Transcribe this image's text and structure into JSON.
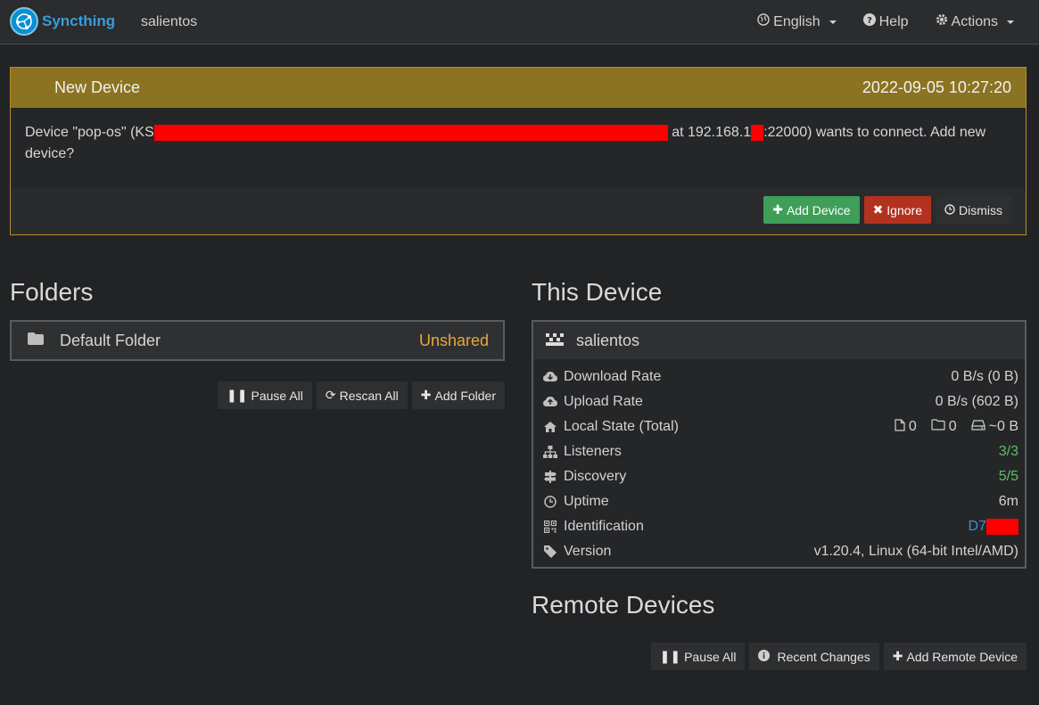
{
  "nav": {
    "brand": "Syncthing",
    "device_name": "salientos",
    "language": "English",
    "help": "Help",
    "actions": "Actions"
  },
  "notice": {
    "title": "New Device",
    "timestamp": "2022-09-05 10:27:20",
    "message_prefix": "Device \"pop-os\" (KS",
    "message_mid": " at 192.168.1",
    "message_suffix": ":22000) wants to connect. Add new device?",
    "add_label": "Add Device",
    "ignore_label": "Ignore",
    "dismiss_label": "Dismiss"
  },
  "folders": {
    "heading": "Folders",
    "items": [
      {
        "name": "Default Folder",
        "status": "Unshared"
      }
    ],
    "pause_all": "Pause All",
    "rescan_all": "Rescan All",
    "add_folder": "Add Folder"
  },
  "this_device": {
    "heading": "This Device",
    "name": "salientos",
    "rows": {
      "download": {
        "label": "Download Rate",
        "value": "0 B/s (0 B)"
      },
      "upload": {
        "label": "Upload Rate",
        "value": "0 B/s (602 B)"
      },
      "local_state": {
        "label": "Local State (Total)",
        "files": "0",
        "dirs": "0",
        "size": "~0 B"
      },
      "listeners": {
        "label": "Listeners",
        "value": "3/3"
      },
      "discovery": {
        "label": "Discovery",
        "value": "5/5"
      },
      "uptime": {
        "label": "Uptime",
        "value": "6m"
      },
      "identification": {
        "label": "Identification",
        "value": "D7"
      },
      "version": {
        "label": "Version",
        "value": "v1.20.4, Linux (64-bit Intel/AMD)"
      }
    }
  },
  "remote": {
    "heading": "Remote Devices",
    "pause_all": "Pause All",
    "recent_changes": "Recent Changes",
    "add_remote": "Add Remote Device"
  },
  "colors": {
    "accent_blue": "#3a9cd6",
    "notice_header": "#8b7321",
    "unshared": "#e8a73c",
    "ok_green": "#5cc165"
  }
}
